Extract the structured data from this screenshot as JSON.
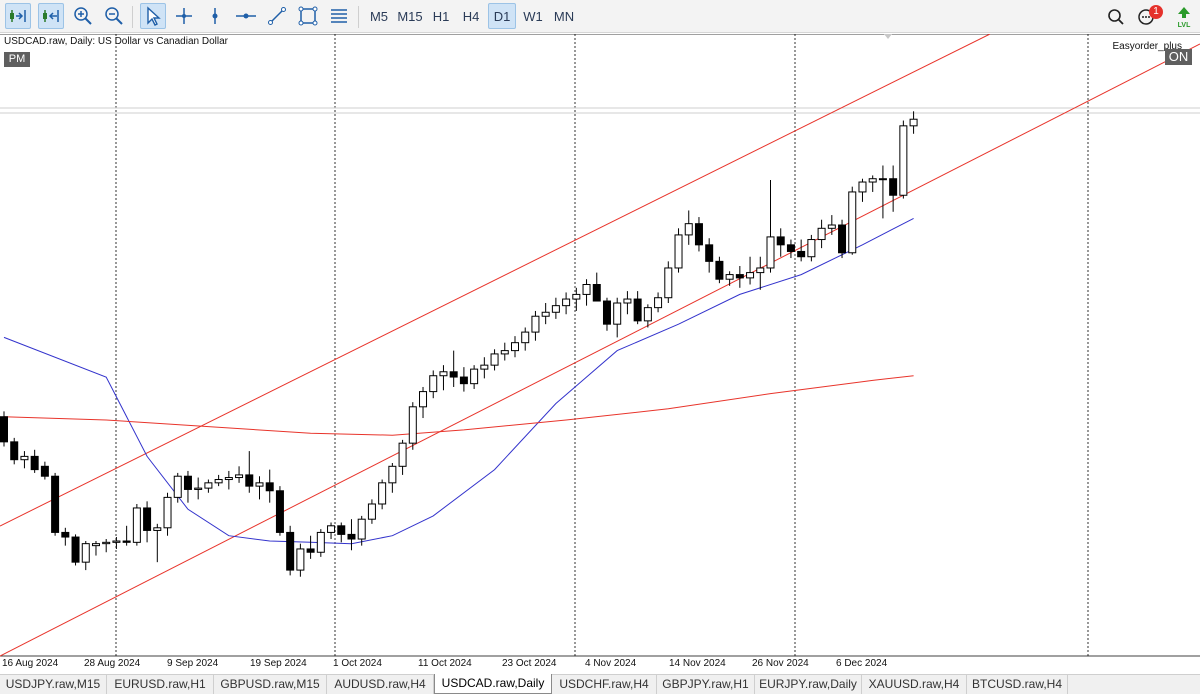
{
  "toolbar": {
    "tools": [
      {
        "icon": "chart-autoscroll-icon",
        "active": true
      },
      {
        "icon": "chart-shift-icon",
        "active": true
      },
      {
        "icon": "zoom-in-icon",
        "active": false
      },
      {
        "icon": "zoom-out-icon",
        "active": false
      },
      {
        "icon": "cursor-icon",
        "active": true
      },
      {
        "icon": "crosshair-icon",
        "active": false
      },
      {
        "icon": "vertical-line-icon",
        "active": false
      },
      {
        "icon": "horizontal-line-icon",
        "active": false
      },
      {
        "icon": "trend-line-icon",
        "active": false
      },
      {
        "icon": "rectangle-icon",
        "active": false
      },
      {
        "icon": "fibonacci-icon",
        "active": false
      }
    ],
    "timeframes": [
      "M5",
      "M15",
      "H1",
      "H4",
      "D1",
      "W1",
      "MN"
    ],
    "active_timeframe": "D1",
    "notifications_count": "1",
    "right_icons": [
      "search-icon",
      "chat-icon",
      "lvl-signal-icon"
    ]
  },
  "chart": {
    "info": "USDCAD.raw, Daily:  US Dollar vs Canadian Dollar",
    "session_badge": "PM",
    "ea_name": "Easyorder_plus",
    "ea_state": "ON",
    "colors": {
      "bull_body": "#ffffff",
      "bear_body": "#000000",
      "wick": "#000000",
      "ma_fast": "#3333cc",
      "ma_slow": "#e8342b",
      "channel": "#e8342b",
      "grid": "#000000"
    }
  },
  "chart_data": {
    "type": "candlestick",
    "symbol": "USDCAD.raw",
    "timeframe": "Daily",
    "date_labels": [
      "16 Aug 2024",
      "28 Aug 2024",
      "9 Sep 2024",
      "19 Sep 2024",
      "1 Oct 2024",
      "11 Oct 2024",
      "23 Oct 2024",
      "4 Nov 2024",
      "14 Nov 2024",
      "26 Nov 2024",
      "6 Dec 2024"
    ],
    "candles": [
      [
        1.37,
        1.3708,
        1.3655,
        1.3662
      ],
      [
        1.3662,
        1.3668,
        1.3628,
        1.3635
      ],
      [
        1.3635,
        1.3648,
        1.3622,
        1.364
      ],
      [
        1.364,
        1.365,
        1.3615,
        1.362
      ],
      [
        1.3625,
        1.3632,
        1.3605,
        1.361
      ],
      [
        1.361,
        1.3615,
        1.352,
        1.3525
      ],
      [
        1.3525,
        1.3532,
        1.3505,
        1.3518
      ],
      [
        1.3518,
        1.3522,
        1.3475,
        1.348
      ],
      [
        1.348,
        1.3512,
        1.3468,
        1.3508
      ],
      [
        1.3505,
        1.3512,
        1.349,
        1.3508
      ],
      [
        1.3508,
        1.3515,
        1.3495,
        1.351
      ],
      [
        1.351,
        1.3518,
        1.35,
        1.3512
      ],
      [
        1.3512,
        1.3535,
        1.3505,
        1.351
      ],
      [
        1.351,
        1.3568,
        1.3505,
        1.3562
      ],
      [
        1.3562,
        1.3572,
        1.351,
        1.3528
      ],
      [
        1.3528,
        1.3538,
        1.348,
        1.3532
      ],
      [
        1.3532,
        1.3585,
        1.352,
        1.3578
      ],
      [
        1.3578,
        1.3615,
        1.357,
        1.361
      ],
      [
        1.361,
        1.3618,
        1.357,
        1.359
      ],
      [
        1.359,
        1.3608,
        1.3575,
        1.3592
      ],
      [
        1.3592,
        1.3605,
        1.3585,
        1.36
      ],
      [
        1.36,
        1.3612,
        1.3595,
        1.3605
      ],
      [
        1.3605,
        1.3618,
        1.359,
        1.3608
      ],
      [
        1.3608,
        1.3625,
        1.36,
        1.3612
      ],
      [
        1.3612,
        1.3648,
        1.3585,
        1.3595
      ],
      [
        1.3595,
        1.361,
        1.3575,
        1.36
      ],
      [
        1.36,
        1.362,
        1.357,
        1.3588
      ],
      [
        1.3588,
        1.3595,
        1.352,
        1.3525
      ],
      [
        1.3525,
        1.3535,
        1.346,
        1.3468
      ],
      [
        1.3468,
        1.3508,
        1.3458,
        1.35
      ],
      [
        1.35,
        1.352,
        1.3485,
        1.3495
      ],
      [
        1.3495,
        1.353,
        1.3488,
        1.3525
      ],
      [
        1.3525,
        1.354,
        1.3515,
        1.3535
      ],
      [
        1.3535,
        1.354,
        1.351,
        1.3522
      ],
      [
        1.3522,
        1.3545,
        1.3498,
        1.3515
      ],
      [
        1.3515,
        1.355,
        1.3505,
        1.3545
      ],
      [
        1.3545,
        1.3575,
        1.3538,
        1.3568
      ],
      [
        1.3568,
        1.3605,
        1.356,
        1.36
      ],
      [
        1.36,
        1.363,
        1.3585,
        1.3625
      ],
      [
        1.3625,
        1.3665,
        1.3612,
        1.366
      ],
      [
        1.366,
        1.3722,
        1.365,
        1.3715
      ],
      [
        1.3715,
        1.3745,
        1.3698,
        1.3738
      ],
      [
        1.3738,
        1.377,
        1.3728,
        1.3762
      ],
      [
        1.3762,
        1.3778,
        1.374,
        1.3768
      ],
      [
        1.3768,
        1.38,
        1.3745,
        1.376
      ],
      [
        1.376,
        1.3775,
        1.3738,
        1.375
      ],
      [
        1.375,
        1.3778,
        1.3742,
        1.3772
      ],
      [
        1.3772,
        1.379,
        1.3758,
        1.3778
      ],
      [
        1.3778,
        1.3802,
        1.377,
        1.3795
      ],
      [
        1.3795,
        1.3812,
        1.3785,
        1.38
      ],
      [
        1.38,
        1.3822,
        1.379,
        1.3812
      ],
      [
        1.3812,
        1.3835,
        1.38,
        1.3828
      ],
      [
        1.3828,
        1.386,
        1.3815,
        1.3852
      ],
      [
        1.3852,
        1.3872,
        1.384,
        1.3858
      ],
      [
        1.3858,
        1.388,
        1.3848,
        1.3868
      ],
      [
        1.3868,
        1.3888,
        1.3855,
        1.3878
      ],
      [
        1.3878,
        1.3895,
        1.386,
        1.3885
      ],
      [
        1.3885,
        1.3908,
        1.3868,
        1.39
      ],
      [
        1.39,
        1.3918,
        1.388,
        1.3875
      ],
      [
        1.3875,
        1.388,
        1.383,
        1.384
      ],
      [
        1.384,
        1.388,
        1.382,
        1.3872
      ],
      [
        1.3872,
        1.389,
        1.3855,
        1.3878
      ],
      [
        1.3878,
        1.389,
        1.384,
        1.3845
      ],
      [
        1.3845,
        1.387,
        1.3835,
        1.3865
      ],
      [
        1.3865,
        1.3888,
        1.3858,
        1.388
      ],
      [
        1.388,
        1.3935,
        1.3872,
        1.3925
      ],
      [
        1.3925,
        1.3985,
        1.3918,
        1.3975
      ],
      [
        1.3975,
        1.4012,
        1.396,
        1.3992
      ],
      [
        1.3992,
        1.4002,
        1.395,
        1.396
      ],
      [
        1.396,
        1.397,
        1.3918,
        1.3935
      ],
      [
        1.3935,
        1.3942,
        1.3902,
        1.3908
      ],
      [
        1.3908,
        1.392,
        1.3898,
        1.3915
      ],
      [
        1.3915,
        1.3928,
        1.3895,
        1.391
      ],
      [
        1.391,
        1.3942,
        1.39,
        1.3918
      ],
      [
        1.3918,
        1.3942,
        1.3892,
        1.3925
      ],
      [
        1.3925,
        1.4058,
        1.3918,
        1.3972
      ],
      [
        1.3972,
        1.3985,
        1.3942,
        1.396
      ],
      [
        1.396,
        1.3968,
        1.394,
        1.395
      ],
      [
        1.395,
        1.3968,
        1.3935,
        1.3942
      ],
      [
        1.3942,
        1.3975,
        1.3935,
        1.3968
      ],
      [
        1.3968,
        1.3998,
        1.3955,
        1.3985
      ],
      [
        1.3985,
        1.4005,
        1.3975,
        1.399
      ],
      [
        1.399,
        1.3998,
        1.394,
        1.3948
      ],
      [
        1.3948,
        1.4048,
        1.3945,
        1.404
      ],
      [
        1.404,
        1.406,
        1.4025,
        1.4055
      ],
      [
        1.4055,
        1.4065,
        1.404,
        1.406
      ],
      [
        1.406,
        1.408,
        1.4,
        1.406
      ],
      [
        1.406,
        1.408,
        1.401,
        1.4035
      ],
      [
        1.4035,
        1.4148,
        1.403,
        1.414
      ],
      [
        1.414,
        1.4162,
        1.4128,
        1.415
      ]
    ],
    "ma_fast": [
      [
        0,
        1.382
      ],
      [
        10,
        1.376
      ],
      [
        14,
        1.364
      ],
      [
        18,
        1.356
      ],
      [
        22,
        1.352
      ],
      [
        26,
        1.3512
      ],
      [
        30,
        1.351
      ],
      [
        34,
        1.3508
      ],
      [
        38,
        1.352
      ],
      [
        42,
        1.355
      ],
      [
        48,
        1.362
      ],
      [
        54,
        1.372
      ],
      [
        60,
        1.38
      ],
      [
        66,
        1.384
      ],
      [
        72,
        1.3885
      ],
      [
        78,
        1.3915
      ],
      [
        84,
        1.396
      ],
      [
        89,
        1.4
      ]
    ],
    "ma_slow": [
      [
        0,
        1.37
      ],
      [
        10,
        1.3695
      ],
      [
        20,
        1.3685
      ],
      [
        30,
        1.3675
      ],
      [
        38,
        1.3672
      ],
      [
        45,
        1.368
      ],
      [
        55,
        1.3695
      ],
      [
        65,
        1.3712
      ],
      [
        75,
        1.3735
      ],
      [
        85,
        1.3755
      ],
      [
        89,
        1.3762
      ]
    ]
  },
  "tabs": [
    {
      "label": "USDJPY.raw,M15",
      "active": false
    },
    {
      "label": "EURUSD.raw,H1",
      "active": false
    },
    {
      "label": "GBPUSD.raw,M15",
      "active": false
    },
    {
      "label": "AUDUSD.raw,H4",
      "active": false
    },
    {
      "label": "USDCAD.raw,Daily",
      "active": true
    },
    {
      "label": "USDCHF.raw,H4",
      "active": false
    },
    {
      "label": "GBPJPY.raw,H1",
      "active": false
    },
    {
      "label": "EURJPY.raw,Daily",
      "active": false
    },
    {
      "label": "XAUUSD.raw,H4",
      "active": false
    },
    {
      "label": "BTCUSD.raw,H4",
      "active": false
    }
  ]
}
